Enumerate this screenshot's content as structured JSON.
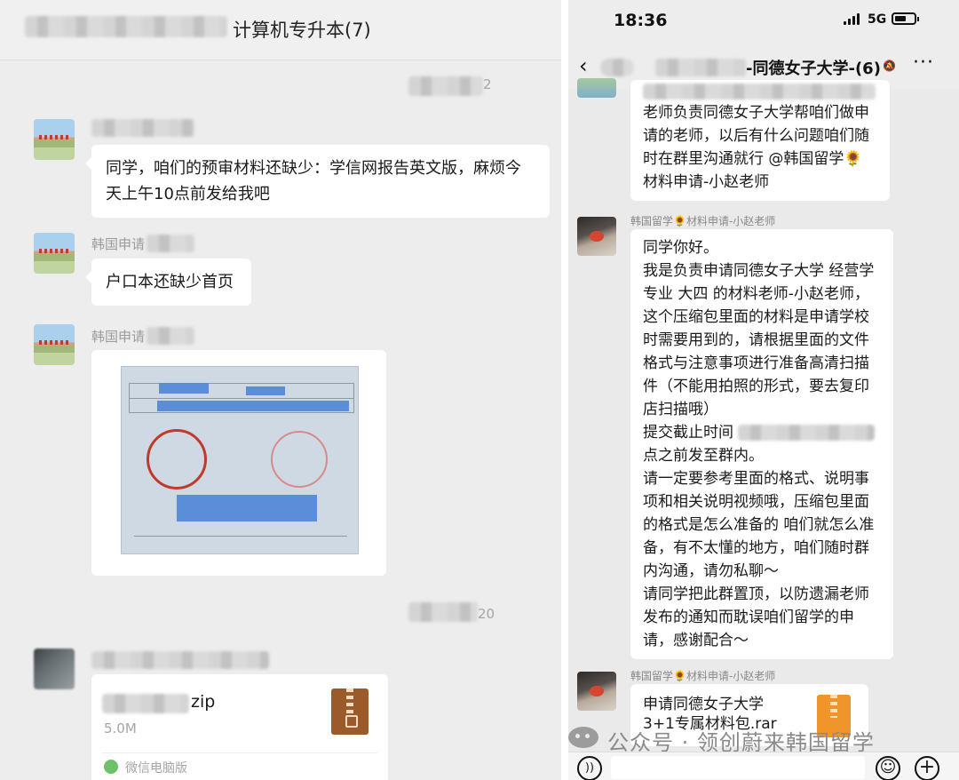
{
  "left": {
    "chat_title": "计算机专升本(7)",
    "time_1_tail": "2",
    "time_2_tail": "20",
    "messages": [
      {
        "sender": "",
        "text": "同学，咱们的预审材料还缺少：学信网报告英文版，麻烦今天上午10点前发给我吧"
      },
      {
        "sender": "韩国申请",
        "text": "户口本还缺少首页"
      },
      {
        "sender": "韩国申请"
      }
    ],
    "file": {
      "ext": "zip",
      "size": "5.0M",
      "source": "微信电脑版"
    }
  },
  "right": {
    "status": {
      "time": "18:36",
      "network": "5G"
    },
    "nav": {
      "back": "‹",
      "title": "-同德女子大学-(6)",
      "more": "···"
    },
    "first_bubble_text": "老师负责同德女子大学帮咱们做申请的老师，以后有什么问题咱们随时在群里沟通就行 @韩国留学🌻材料申请-小赵老师",
    "sender_name": "韩国留学🌻材料申请-小赵老师",
    "message_part1": "同学你好。\n我是负责申请同德女子大学  经营学专业 大四 的材料老师-小赵老师，这个压缩包里面的材料是申请学校时需要用到的，请根据里面的文件格式与注意事项进行准备高清扫描件（不能用拍照的形式，要去复印店扫描哦）\n提交截止时间",
    "message_part2": "点之前发至群内。\n请一定要参考里面的格式、说明事项和相关说明视频哦，压缩包里面的格式是怎么准备的 咱们就怎么准备，有不太懂的地方，咱们随时群内沟通，请勿私聊～\n请同学把此群置顶，以防遗漏老师发布的通知而耽误咱们留学的申请，感谢配合～",
    "file_name": "申请同德女子大学\n3+1专属材料包.rar",
    "watermark": "公众号 · 领创蔚来韩国留学"
  },
  "icons": {
    "zip": "zip-file-icon",
    "voice": "voice-icon",
    "emoji": "emoji-icon",
    "plus": "plus-icon"
  },
  "colors": {
    "bubble": "#ffffff",
    "chat_bg": "#ededed",
    "redaction": "#5b8ed8",
    "seal": "#c0392b"
  }
}
